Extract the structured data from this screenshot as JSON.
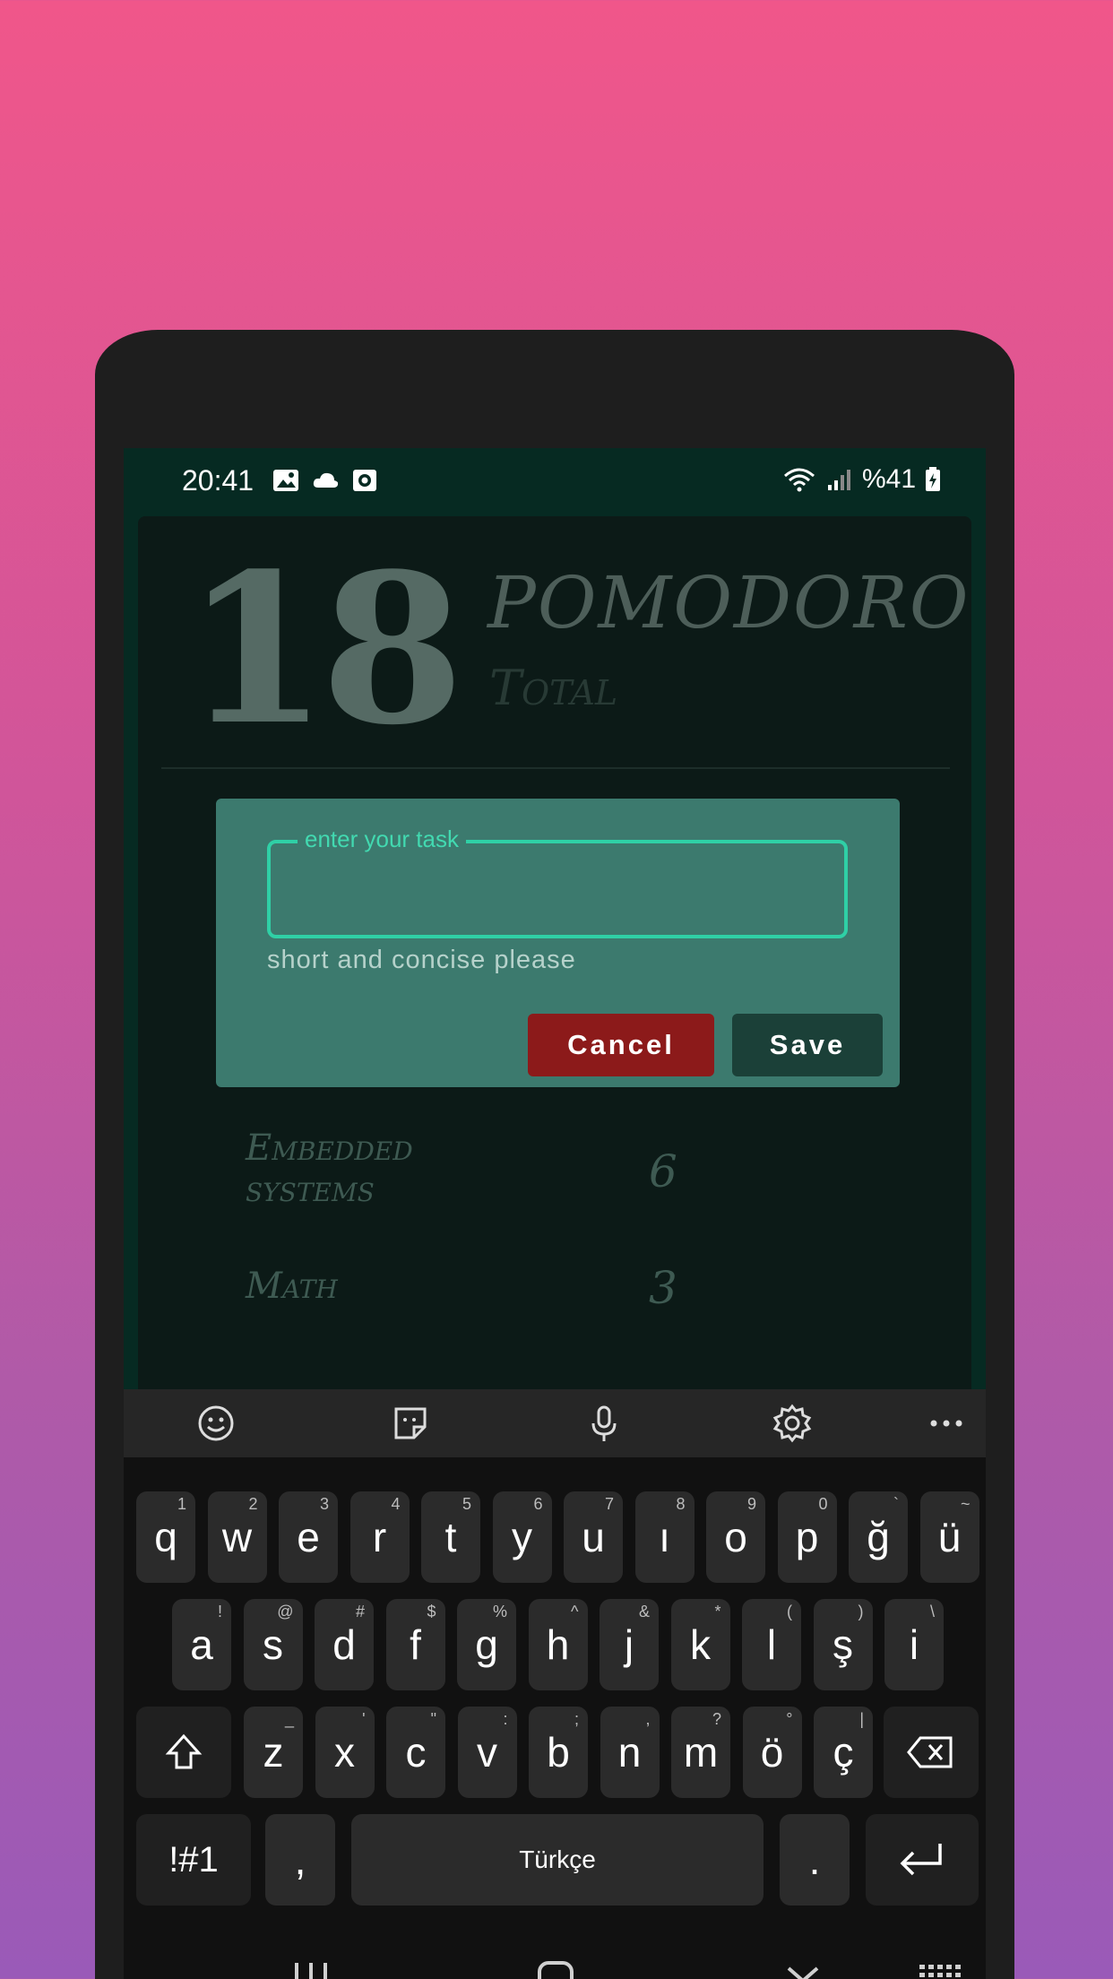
{
  "status_bar": {
    "time": "20:41",
    "battery": "%41"
  },
  "app": {
    "total_count": "18",
    "title": "POMODORO",
    "subtitle": "Total",
    "rows": [
      {
        "name": "Embedded systems",
        "value": "6"
      },
      {
        "name": "Math",
        "value": "3"
      }
    ]
  },
  "dialog": {
    "field_label": "enter your task",
    "field_value": "",
    "helper_text": "short and concise please",
    "cancel_label": "Cancel",
    "save_label": "Save"
  },
  "keyboard": {
    "row1": [
      {
        "k": "q",
        "s": "1"
      },
      {
        "k": "w",
        "s": "2"
      },
      {
        "k": "e",
        "s": "3"
      },
      {
        "k": "r",
        "s": "4"
      },
      {
        "k": "t",
        "s": "5"
      },
      {
        "k": "y",
        "s": "6"
      },
      {
        "k": "u",
        "s": "7"
      },
      {
        "k": "ı",
        "s": "8"
      },
      {
        "k": "o",
        "s": "9"
      },
      {
        "k": "p",
        "s": "0"
      },
      {
        "k": "ğ",
        "s": "`"
      },
      {
        "k": "ü",
        "s": "~"
      }
    ],
    "row2": [
      {
        "k": "a",
        "s": "!"
      },
      {
        "k": "s",
        "s": "@"
      },
      {
        "k": "d",
        "s": "#"
      },
      {
        "k": "f",
        "s": "$"
      },
      {
        "k": "g",
        "s": "%"
      },
      {
        "k": "h",
        "s": "^"
      },
      {
        "k": "j",
        "s": "&"
      },
      {
        "k": "k",
        "s": "*"
      },
      {
        "k": "l",
        "s": "("
      },
      {
        "k": "ş",
        "s": ")"
      },
      {
        "k": "i",
        "s": "\\"
      }
    ],
    "row3": [
      {
        "k": "z",
        "s": "_"
      },
      {
        "k": "x",
        "s": "'"
      },
      {
        "k": "c",
        "s": "\""
      },
      {
        "k": "v",
        "s": ":"
      },
      {
        "k": "b",
        "s": ";"
      },
      {
        "k": "n",
        "s": ","
      },
      {
        "k": "m",
        "s": "?"
      },
      {
        "k": "ö",
        "s": "°"
      },
      {
        "k": "ç",
        "s": "|"
      }
    ],
    "symbols_label": "!#1",
    "comma_label": ",",
    "space_label": "Türkçe",
    "period_label": "."
  }
}
